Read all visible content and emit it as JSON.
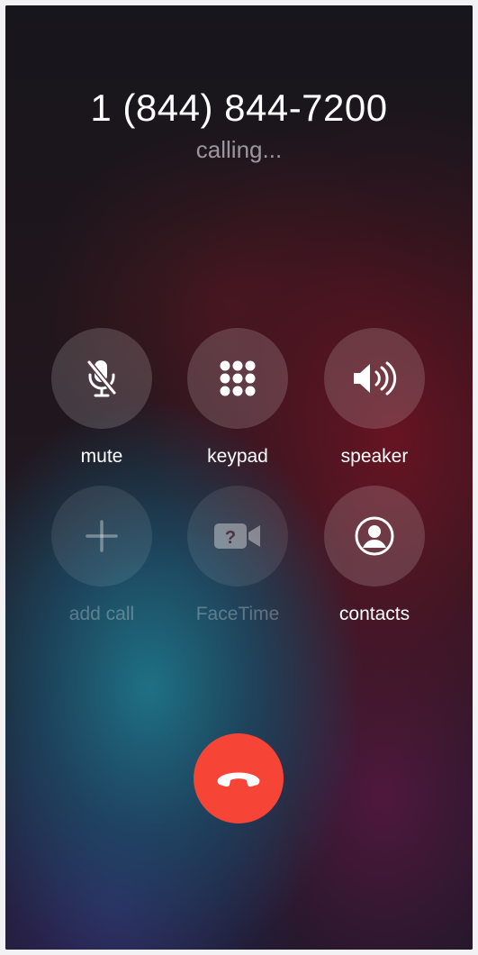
{
  "call": {
    "number": "1 (844) 844-7200",
    "status": "calling..."
  },
  "controls": [
    {
      "label": "mute",
      "icon": "mic-slash-icon",
      "enabled": true
    },
    {
      "label": "keypad",
      "icon": "keypad-icon",
      "enabled": true
    },
    {
      "label": "speaker",
      "icon": "speaker-icon",
      "enabled": true
    },
    {
      "label": "add call",
      "icon": "plus-icon",
      "enabled": false
    },
    {
      "label": "FaceTime",
      "icon": "facetime-unknown-icon",
      "enabled": false
    },
    {
      "label": "contacts",
      "icon": "person-circle-icon",
      "enabled": true
    }
  ],
  "end_call": {
    "icon": "phone-down-icon",
    "color": "#f64437"
  }
}
